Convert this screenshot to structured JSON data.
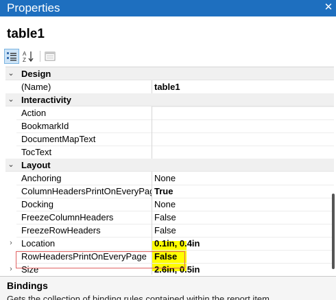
{
  "window": {
    "title": "Properties",
    "close_glyph": "✕"
  },
  "object_name": "table1",
  "toolbar": {
    "buttons": [
      {
        "name": "categorized-view-icon"
      },
      {
        "name": "alphabetical-sort-icon"
      },
      {
        "name": "property-pages-icon"
      }
    ]
  },
  "grid": {
    "rows": [
      {
        "kind": "cat",
        "label": "Design",
        "expander": "⌄"
      },
      {
        "kind": "prop",
        "name": "(Name)",
        "value": "table1",
        "style": "bold"
      },
      {
        "kind": "cat",
        "label": "Interactivity",
        "expander": "⌄"
      },
      {
        "kind": "prop",
        "name": "Action",
        "value": "",
        "style": "default"
      },
      {
        "kind": "prop",
        "name": "BookmarkId",
        "value": "",
        "style": "default"
      },
      {
        "kind": "prop",
        "name": "DocumentMapText",
        "value": "",
        "style": "default"
      },
      {
        "kind": "prop",
        "name": "TocText",
        "value": "",
        "style": "default"
      },
      {
        "kind": "cat",
        "label": "Layout",
        "expander": "⌄"
      },
      {
        "kind": "prop",
        "name": "Anchoring",
        "value": "None",
        "style": "default"
      },
      {
        "kind": "prop",
        "name": "ColumnHeadersPrintOnEveryPage",
        "value": "True",
        "style": "hl"
      },
      {
        "kind": "prop",
        "name": "Docking",
        "value": "None",
        "style": "default"
      },
      {
        "kind": "prop",
        "name": "FreezeColumnHeaders",
        "value": "False",
        "style": "default"
      },
      {
        "kind": "prop",
        "name": "FreezeRowHeaders",
        "value": "False",
        "style": "default"
      },
      {
        "kind": "prop",
        "name": "Location",
        "value": "0.1in, 0.4in",
        "style": "bold",
        "expander": "›"
      },
      {
        "kind": "prop",
        "name": "RowHeadersPrintOnEveryPage",
        "value": "False",
        "style": "bold"
      },
      {
        "kind": "prop",
        "name": "Size",
        "value": "2.6in, 0.5in",
        "style": "bold",
        "expander": "›"
      }
    ]
  },
  "description": {
    "title": "Bindings",
    "text": "Gets the collection of binding rules contained within the report item."
  },
  "colors": {
    "titlebar": "#1e6fbf",
    "highlight": "#ffff00",
    "callout": "#e06060"
  }
}
